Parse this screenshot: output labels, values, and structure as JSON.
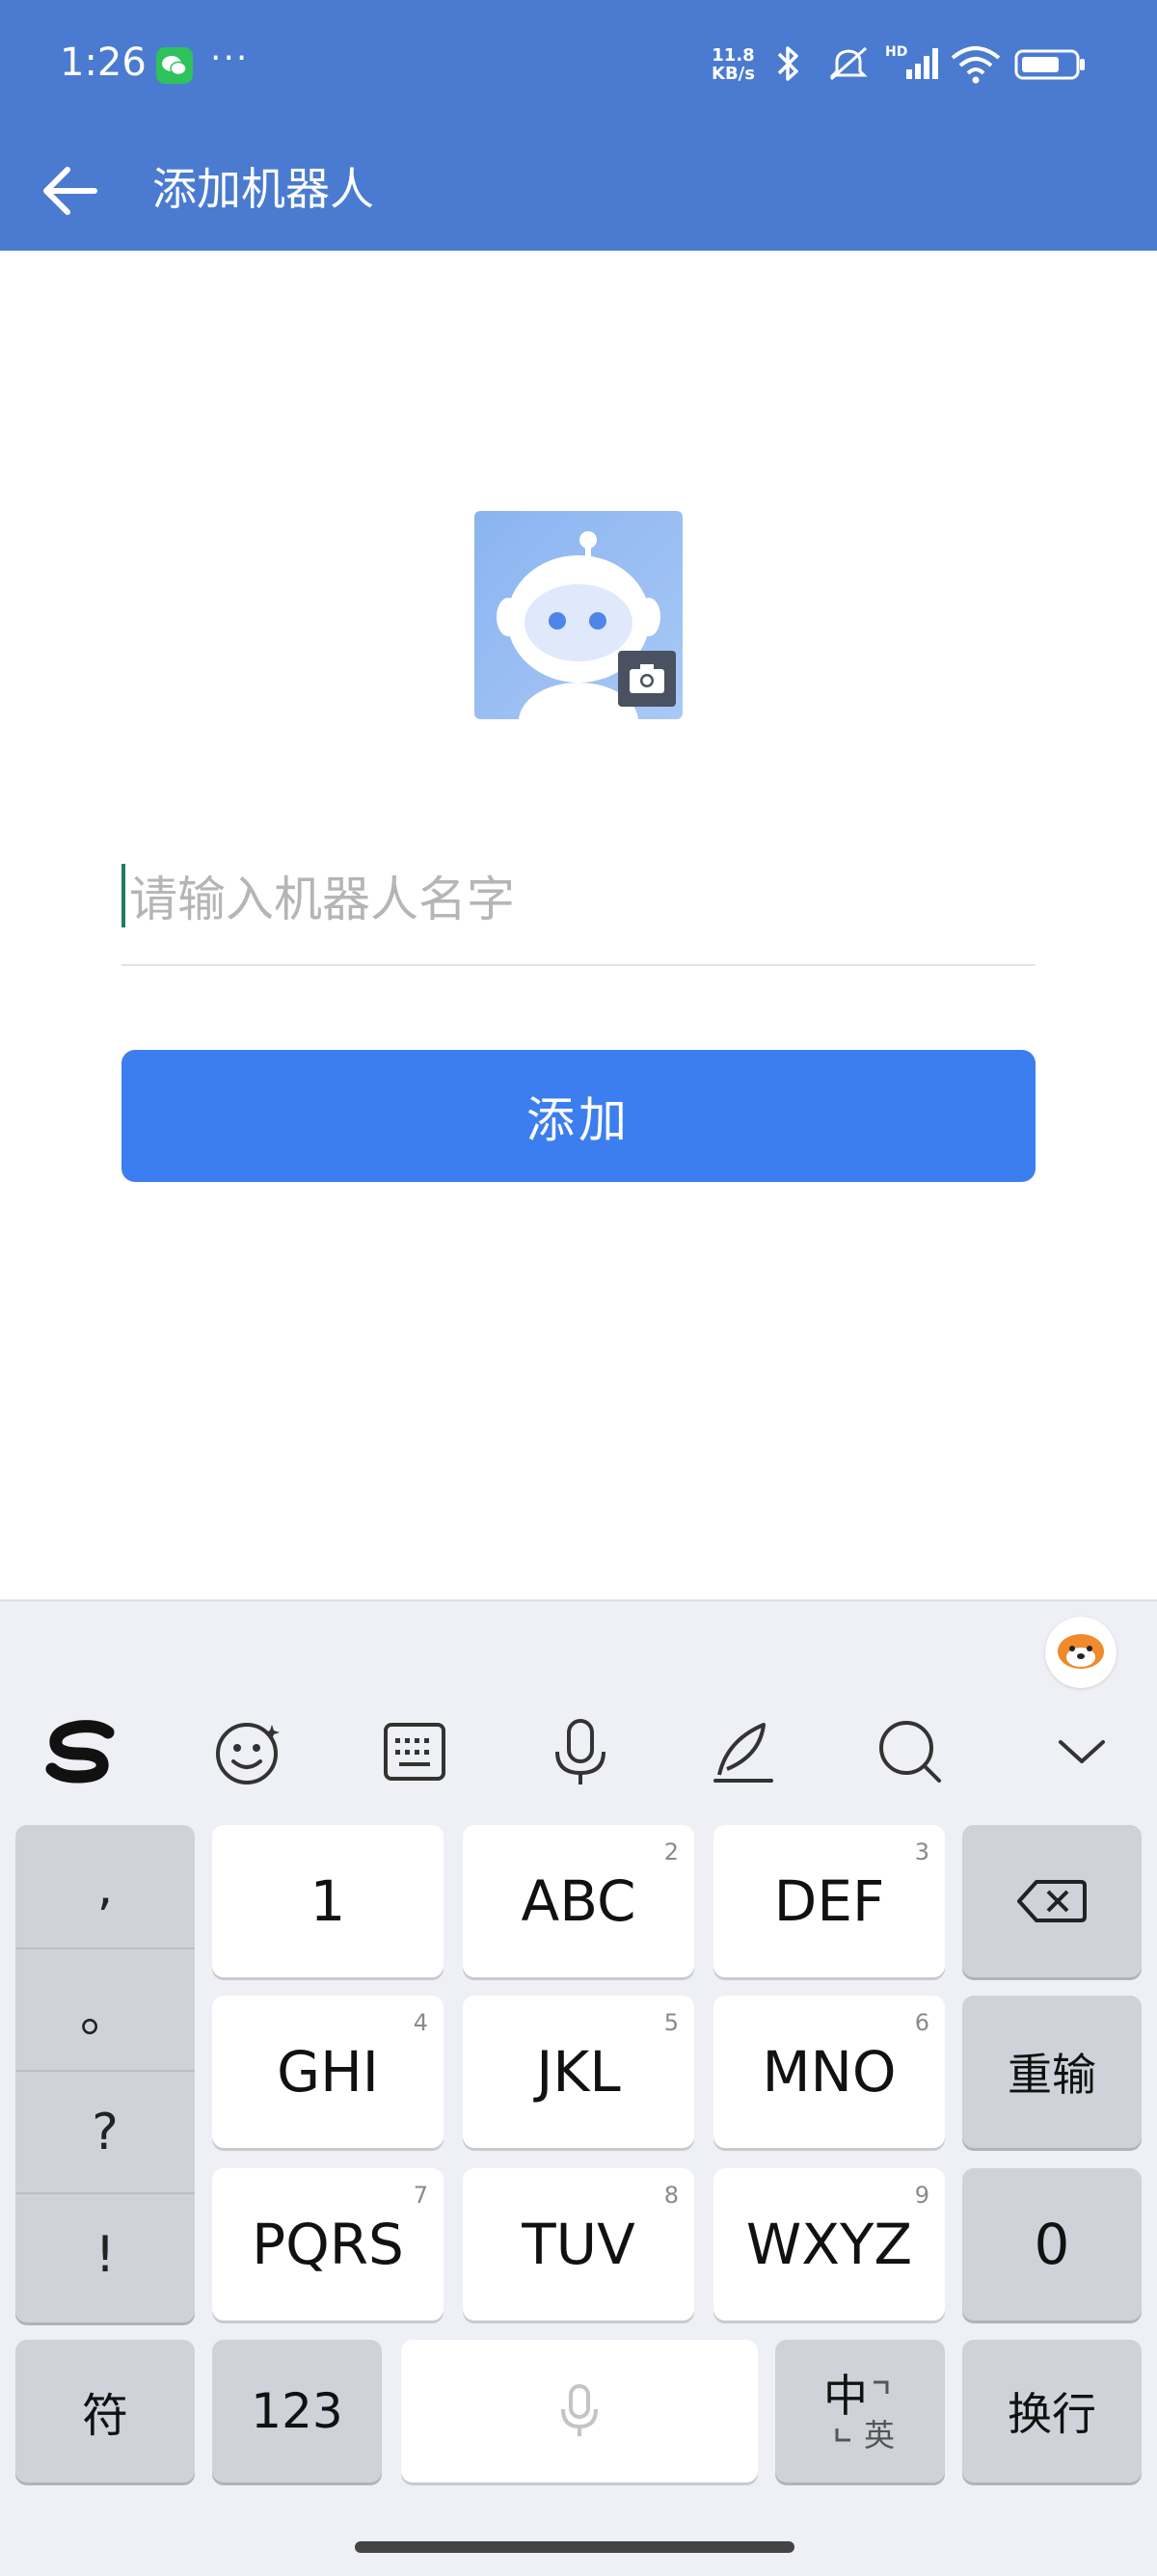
{
  "status_bar": {
    "time": "1:26",
    "more": "···",
    "net_speed_value": "11.8",
    "net_speed_unit": "KB/s",
    "icons": [
      "wechat-icon",
      "bluetooth-icon",
      "mute-icon",
      "hd-signal-icon",
      "wifi-icon",
      "battery-icon"
    ]
  },
  "app_bar": {
    "title": "添加机器人"
  },
  "form": {
    "name_placeholder": "请输入机器人名字",
    "name_value": "",
    "add_label": "添加"
  },
  "keyboard": {
    "toolbar": [
      "sogou-logo-icon",
      "emoji-icon",
      "keyboard-icon",
      "mic-icon",
      "handwriting-icon",
      "search-icon",
      "collapse-icon"
    ],
    "punctuation": [
      ",",
      "。",
      "?",
      "!"
    ],
    "keys": {
      "k1": {
        "main": "1",
        "sub": ""
      },
      "k2": {
        "main": "ABC",
        "sub": "2"
      },
      "k3": {
        "main": "DEF",
        "sub": "3"
      },
      "k4": {
        "main": "GHI",
        "sub": "4"
      },
      "k5": {
        "main": "JKL",
        "sub": "5"
      },
      "k6": {
        "main": "MNO",
        "sub": "6"
      },
      "k7": {
        "main": "PQRS",
        "sub": "7"
      },
      "k8": {
        "main": "TUV",
        "sub": "8"
      },
      "k9": {
        "main": "WXYZ",
        "sub": "9"
      }
    },
    "reenter": "重输",
    "zero": "0",
    "symbols": "符",
    "numbers": "123",
    "lang_main": "中",
    "lang_sub": "英",
    "newline": "换行"
  }
}
